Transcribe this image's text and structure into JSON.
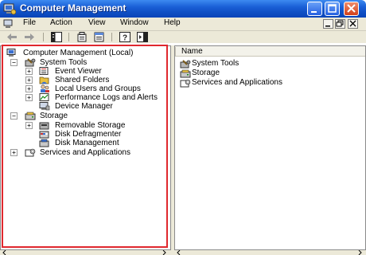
{
  "window": {
    "title": "Computer Management",
    "controls": [
      "minimize",
      "maximize",
      "close"
    ]
  },
  "menu": {
    "items": [
      "File",
      "Action",
      "View",
      "Window",
      "Help"
    ]
  },
  "toolbar": {
    "icons": [
      "back-arrow-icon",
      "forward-arrow-icon",
      "show-hide-tree-icon",
      "properties-icon",
      "export-list-icon",
      "help-icon",
      "action-pane-icon"
    ]
  },
  "tree": {
    "root": "Computer Management (Local)",
    "system_tools": {
      "label": "System Tools",
      "children": [
        "Event Viewer",
        "Shared Folders",
        "Local Users and Groups",
        "Performance Logs and Alerts",
        "Device Manager"
      ]
    },
    "storage": {
      "label": "Storage",
      "children": [
        "Removable Storage",
        "Disk Defragmenter",
        "Disk Management"
      ]
    },
    "services": "Services and Applications"
  },
  "list": {
    "column_name": "Name",
    "rows": [
      "System Tools",
      "Storage",
      "Services and Applications"
    ]
  },
  "colors": {
    "titlebar": "#0f4fc4",
    "chrome": "#ece9d8",
    "highlight_border": "#e0282e"
  }
}
